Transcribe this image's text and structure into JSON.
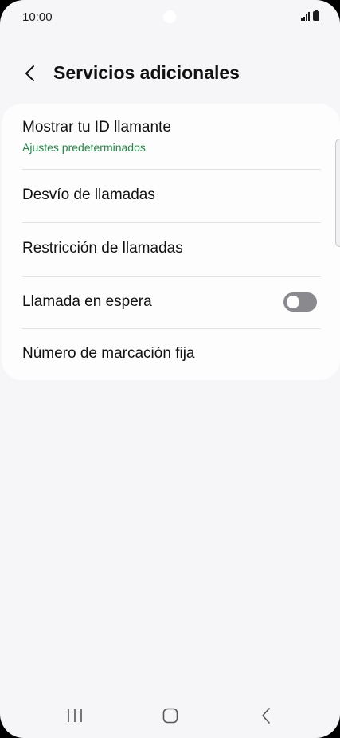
{
  "status_bar": {
    "time": "10:00"
  },
  "header": {
    "title": "Servicios adicionales",
    "back_icon": "chevron-left-icon"
  },
  "settings": {
    "items": [
      {
        "label": "Mostrar tu ID llamante",
        "subtitle": "Ajustes predeterminados"
      },
      {
        "label": "Desvío de llamadas"
      },
      {
        "label": "Restricción de llamadas"
      },
      {
        "label": "Llamada en espera",
        "toggle_on": false
      },
      {
        "label": "Número de marcación fija"
      }
    ]
  },
  "nav_bar": {
    "icons": [
      "recent-apps-icon",
      "home-icon",
      "back-icon"
    ]
  },
  "colors": {
    "background": "#f6f6f8",
    "card": "#fdfdfe",
    "accent_subtitle": "#218a45",
    "toggle_off": "#8a8a8e"
  }
}
